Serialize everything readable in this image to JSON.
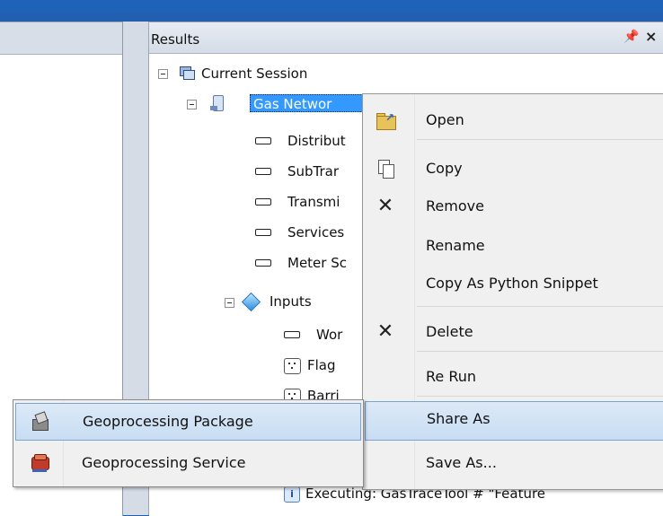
{
  "panel": {
    "title": "Results",
    "pin_glyph": "ɰ",
    "close_glyph": "×"
  },
  "tree": {
    "session": "Current Session",
    "tool": "Gas Networ",
    "params": [
      "Distribut",
      "SubTrar",
      "Transmi",
      "Services",
      "Meter Sc"
    ],
    "inputs": "Inputs",
    "input_items": [
      "Wor",
      "Flag",
      "Barri"
    ],
    "executing": "Executing: GasTraceTool # \"Feature"
  },
  "context_menu": {
    "items": [
      {
        "label": "Open",
        "icon": "folder-open-icon"
      },
      {
        "label": "Copy",
        "icon": "copy-icon"
      },
      {
        "label": "Remove",
        "icon": "x-icon"
      },
      {
        "label": "Rename",
        "icon": ""
      },
      {
        "label": "Copy As Python Snippet",
        "icon": ""
      },
      {
        "label": "Delete",
        "icon": "x-icon"
      },
      {
        "label": "Re Run",
        "icon": ""
      },
      {
        "label": "Share As",
        "icon": "",
        "highlighted": true
      },
      {
        "label": "Save As...",
        "icon": ""
      }
    ]
  },
  "submenu": {
    "items": [
      {
        "label": "Geoprocessing Package",
        "icon": "geoprocessing-package-icon",
        "highlighted": true
      },
      {
        "label": "Geoprocessing Service",
        "icon": "geoprocessing-service-icon"
      }
    ]
  },
  "colors": {
    "desktop": "#1d5fb4",
    "selection": "#3399ff",
    "menu_highlight": "#c8ddf3"
  }
}
